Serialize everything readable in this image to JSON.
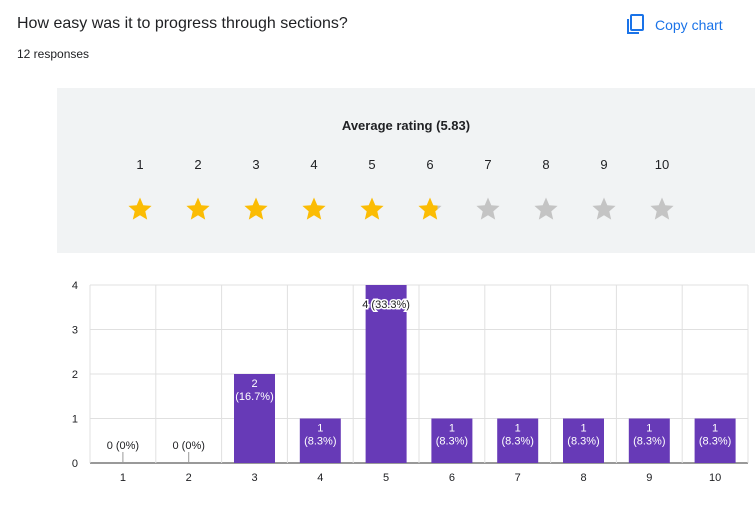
{
  "question": {
    "title": "How easy was it to progress through sections?",
    "responses": "12 responses"
  },
  "toolbar": {
    "copy_label": "Copy chart"
  },
  "rating": {
    "label": "Average rating",
    "average": 5.83,
    "average_text": "(5.83)",
    "scale": [
      "1",
      "2",
      "3",
      "4",
      "5",
      "6",
      "7",
      "8",
      "9",
      "10"
    ],
    "filled_color": "#fbbc04",
    "empty_color": "#c4c4c4"
  },
  "chart_data": {
    "type": "bar",
    "categories": [
      "1",
      "2",
      "3",
      "4",
      "5",
      "6",
      "7",
      "8",
      "9",
      "10"
    ],
    "values": [
      0,
      0,
      2,
      1,
      4,
      1,
      1,
      1,
      1,
      1
    ],
    "data_labels": [
      "0 (0%)",
      "0 (0%)",
      "2 (16.7%)",
      "1 (8.3%)",
      "4 (33.3%)",
      "1 (8.3%)",
      "1 (8.3%)",
      "1 (8.3%)",
      "1 (8.3%)",
      "1 (8.3%)"
    ],
    "ylim": [
      0,
      4
    ],
    "yticks": [
      0,
      1,
      2,
      3,
      4
    ],
    "bar_color": "#673ab7",
    "grid": true
  }
}
